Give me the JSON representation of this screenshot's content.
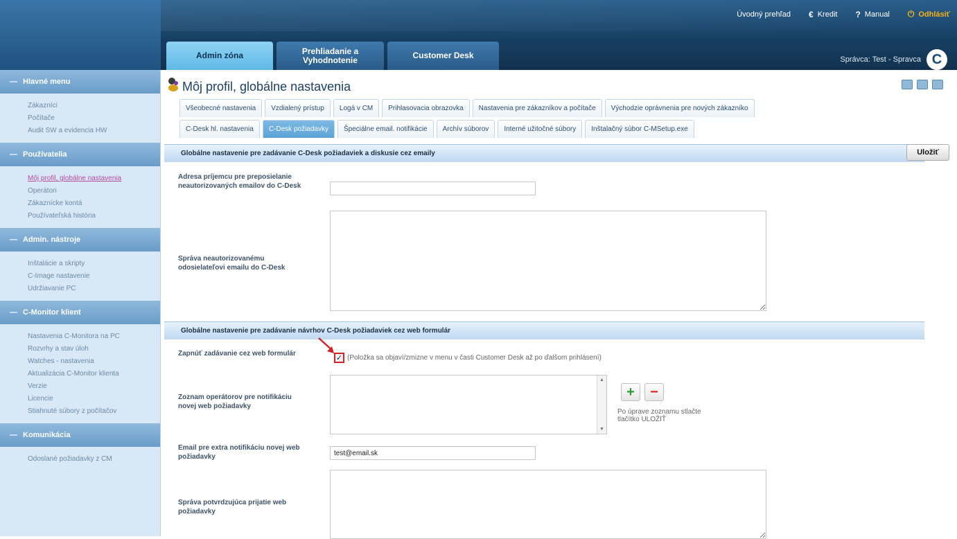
{
  "top_nav": {
    "overview": "Úvodný prehľad",
    "credit": "Kredit",
    "manual": "Manual",
    "logout": "Odhlásiť"
  },
  "main_tabs": [
    {
      "label": "Admin zóna",
      "active": true
    },
    {
      "label": "Prehliadanie a Vyhodnotenie",
      "active": false
    },
    {
      "label": "Customer Desk",
      "active": false
    }
  ],
  "user_info": "Správca: Test - Spravca",
  "logo_letter": "C",
  "sidebar": {
    "sections": [
      {
        "title": "Hlavné menu",
        "items": [
          "Zákazníci",
          "Počítače",
          "Audit SW a evidencia HW"
        ]
      },
      {
        "title": "Používatelia",
        "items": [
          "Môj profil, globálne nastavenia",
          "Operátori",
          "Zákaznícke kontá",
          "Používateľská história"
        ]
      },
      {
        "title": "Admin. nástroje",
        "items": [
          "Inštalácie a skripty",
          "C-Image nastavenie",
          "Udržiavanie PC"
        ]
      },
      {
        "title": "C-Monitor klient",
        "items": [
          "Nastavenia C-Monitora na PC",
          "Rozvrhy a stav úloh",
          "Watches - nastavenia",
          "Aktualizácia C-Monitor klienta",
          "Verzie",
          "Licencie",
          "Stiahnuté súbory z počítačov"
        ]
      },
      {
        "title": "Komunikácia",
        "items": [
          "Odoslané požiadavky z CM"
        ]
      }
    ]
  },
  "page": {
    "title": "Môj profil, globálne nastavenia",
    "tabs_row1": [
      "Všeobecné nastavenia",
      "Vzdialený prístup",
      "Logá v CM",
      "Prihlasovacia obrazovka",
      "Nastavenia pre zákazníkov a počítače",
      "Východzie oprávnenia pre nových zákazníko"
    ],
    "tabs_row2": [
      "C-Desk hl. nastavenia",
      "C-Desk požiadavky",
      "Špeciálne email. notifikácie",
      "Archív súborov",
      "Interné užitočné súbory",
      "Inštalačný súbor C-MSetup.exe"
    ],
    "active_tab_row2": "C-Desk požiadavky",
    "save_label": "Uložiť"
  },
  "email_section": {
    "heading": "Globálne nastavenie pre zadávanie C-Desk požiadaviek a diskusie cez emaily",
    "forward_label": "Adresa príjemcu pre preposielanie neautorizovaných emailov do C-Desk",
    "forward_value": "",
    "message_label": "Správa neautorizovanému odosielateľovi emailu do C-Desk",
    "message_value": ""
  },
  "web_section": {
    "heading": "Globálne nastavenie pre zadávanie návrhov C-Desk požiadaviek cez web formulár",
    "enable_label": "Zapnúť zadávanie cez web formulár",
    "enable_checked": true,
    "enable_note": "(Položka sa objaví/zmizne v menu v časti Customer Desk až po ďalšom prihlásení)",
    "operators_label": "Zoznam operátorov pre notifikáciu novej web požiadavky",
    "list_hint": "Po úprave zoznamu stlačte tlačítko ULOŽIŤ",
    "extra_email_label": "Email pre extra notifikáciu novej web požiadavky",
    "extra_email_value": "test@email.sk",
    "confirm_label": "Správa potvrdzujúca prijatie web požiadavky"
  }
}
